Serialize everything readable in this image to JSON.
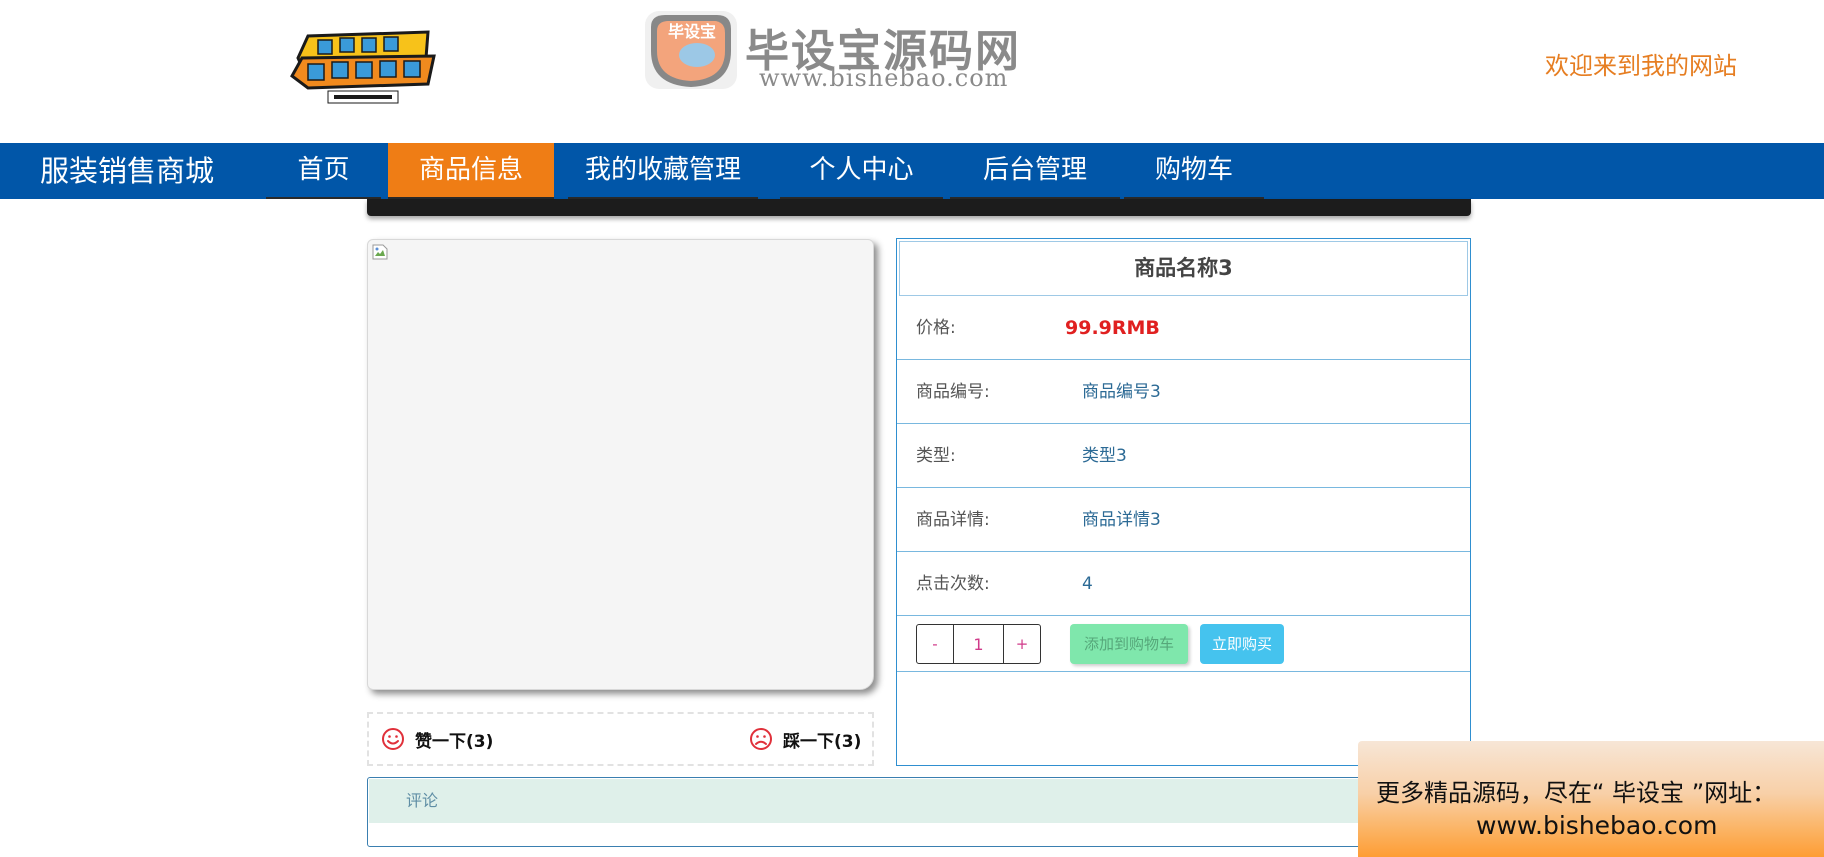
{
  "header": {
    "logo_icon": "digimon-adventure-logo",
    "brand_badge_text": "毕设宝",
    "brand_title": "毕设宝源码网",
    "brand_url": "www.bishebao.com",
    "welcome": "欢迎来到我的网站"
  },
  "nav": {
    "brand": "服装销售商城",
    "items": [
      {
        "label": "首页",
        "active": false
      },
      {
        "label": "商品信息",
        "active": true
      },
      {
        "label": "我的收藏管理",
        "active": false
      },
      {
        "label": "个人中心",
        "active": false
      },
      {
        "label": "后台管理",
        "active": false
      },
      {
        "label": "购物车",
        "active": false
      }
    ]
  },
  "product": {
    "image_icon": "broken-image-icon",
    "title": "商品名称3",
    "rows": [
      {
        "label": "价格:",
        "value": "99.9RMB"
      },
      {
        "label": "商品编号:",
        "value": "商品编号3"
      },
      {
        "label": "类型:",
        "value": "类型3"
      },
      {
        "label": "商品详情:",
        "value": "商品详情3"
      },
      {
        "label": "点击次数:",
        "value": "4"
      }
    ],
    "quantity": {
      "minus": "-",
      "value": "1",
      "plus": "+"
    },
    "add_to_cart": "添加到购物车",
    "buy_now": "立即购买"
  },
  "votes": {
    "like": "赞一下(3)",
    "dislike": "踩一下(3)"
  },
  "comments": {
    "label": "评论"
  },
  "promo": {
    "line1": "更多精品源码，尽在“ 毕设宝 ”网址：",
    "line2": "www.bishebao.com"
  },
  "colors": {
    "nav_bg": "#0156a8",
    "nav_active": "#ef7d15",
    "price": "#e02020",
    "welcome": "#e67e22",
    "vote_icon": "#e0303a"
  }
}
